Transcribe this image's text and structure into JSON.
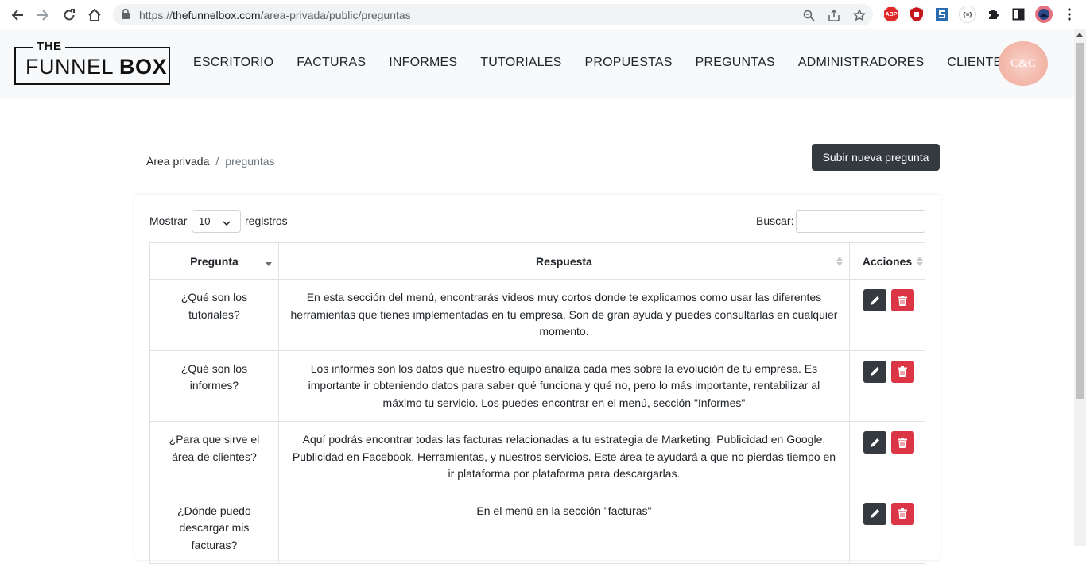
{
  "browser": {
    "url_prefix": "https://",
    "url_host": "thefunnelbox.com",
    "url_path": "/area-privada/public/preguntas",
    "extensions": {
      "abp_label": "ABP",
      "json_label": "{≡}"
    }
  },
  "header": {
    "logo_the": "THE",
    "logo_funnel": "FUNNEL ",
    "logo_box": "BOX",
    "menu": [
      "ESCRITORIO",
      "FACTURAS",
      "INFORMES",
      "TUTORIALES",
      "PROPUESTAS",
      "PREGUNTAS",
      "ADMINISTRADORES",
      "CLIENTES"
    ],
    "avatar_text": "C&C"
  },
  "breadcrumb": {
    "root": "Área privada",
    "separator": "/",
    "current": "preguntas"
  },
  "upload_button": "Subir nueva pregunta",
  "table_controls": {
    "show_label": "Mostrar",
    "page_length": "10",
    "after_label": "registros",
    "search_label": "Buscar:",
    "search_value": ""
  },
  "table": {
    "headers": [
      "Pregunta",
      "Respuesta",
      "Acciones"
    ],
    "rows": [
      {
        "pregunta": "¿Qué son los tutoriales?",
        "respuesta": "En esta sección del menú, encontrarás videos muy cortos donde te explicamos como usar las diferentes herramientas que tienes implementadas en tu empresa. Son de gran ayuda y puedes consultarlas en cualquier momento."
      },
      {
        "pregunta": "¿Qué son los informes?",
        "respuesta": "Los informes son los datos que nuestro equipo analiza cada mes sobre la evolución de tu empresa. Es importante ir obteniendo datos para saber qué funciona y qué no, pero lo más importante, rentabilizar al máximo tu servicio. Los puedes encontrar en el menú, sección \"Informes\""
      },
      {
        "pregunta": "¿Para que sirve el área de clientes?",
        "respuesta": "Aquí podrás encontrar todas las facturas relacionadas a tu estrategia de Marketing: Publicidad en Google, Publicidad en Facebook, Herramientas, y nuestros servicios. Este área te ayudará a que no pierdas tiempo en ir plataforma por plataforma para descargarlas."
      },
      {
        "pregunta": "¿Dónde puedo descargar mis facturas?",
        "respuesta": "En el menú en la sección \"facturas\""
      }
    ]
  },
  "colors": {
    "dark": "#343a40",
    "danger": "#dc3545",
    "header_bg": "#f8f9fa"
  }
}
